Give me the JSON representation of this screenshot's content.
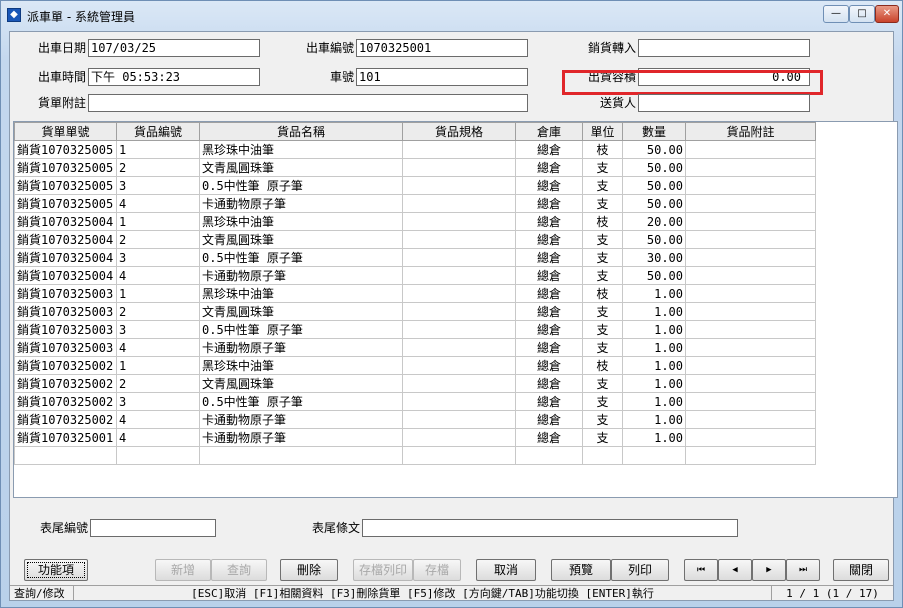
{
  "window": {
    "title": "派車單 - 系統管理員",
    "app_icon": "app-icon"
  },
  "header": {
    "ship_date_label": "出車日期",
    "ship_date_value": "107/03/25",
    "ship_no_label": "出車編號",
    "ship_no_value": "1070325001",
    "sales_import_label": "銷貨轉入",
    "sales_import_value": "",
    "ship_time_label": "出車時間",
    "ship_time_value": "下午 05:53:23",
    "car_no_label": "車號",
    "car_no_value": "101",
    "volume_label": "出貨容積",
    "volume_value": "0.00",
    "note_label": "貨單附註",
    "note_value": "",
    "sender_label": "送貨人",
    "sender_value": "",
    "highlight_color": "#e0262a"
  },
  "table": {
    "columns": [
      "貨單單號",
      "貨品編號",
      "貨品名稱",
      "貨品規格",
      "倉庫",
      "單位",
      "數量",
      "貨品附註"
    ],
    "rows": [
      [
        "銷貨1070325005",
        "1",
        "黑珍珠中油筆",
        "",
        "總倉",
        "枝",
        "50.00",
        ""
      ],
      [
        "銷貨1070325005",
        "2",
        "文青風圓珠筆",
        "",
        "總倉",
        "支",
        "50.00",
        ""
      ],
      [
        "銷貨1070325005",
        "3",
        "0.5中性筆 原子筆",
        "",
        "總倉",
        "支",
        "50.00",
        ""
      ],
      [
        "銷貨1070325005",
        "4",
        "卡通動物原子筆",
        "",
        "總倉",
        "支",
        "50.00",
        ""
      ],
      [
        "銷貨1070325004",
        "1",
        "黑珍珠中油筆",
        "",
        "總倉",
        "枝",
        "20.00",
        ""
      ],
      [
        "銷貨1070325004",
        "2",
        "文青風圓珠筆",
        "",
        "總倉",
        "支",
        "50.00",
        ""
      ],
      [
        "銷貨1070325004",
        "3",
        "0.5中性筆 原子筆",
        "",
        "總倉",
        "支",
        "30.00",
        ""
      ],
      [
        "銷貨1070325004",
        "4",
        "卡通動物原子筆",
        "",
        "總倉",
        "支",
        "50.00",
        ""
      ],
      [
        "銷貨1070325003",
        "1",
        "黑珍珠中油筆",
        "",
        "總倉",
        "枝",
        "1.00",
        ""
      ],
      [
        "銷貨1070325003",
        "2",
        "文青風圓珠筆",
        "",
        "總倉",
        "支",
        "1.00",
        ""
      ],
      [
        "銷貨1070325003",
        "3",
        "0.5中性筆 原子筆",
        "",
        "總倉",
        "支",
        "1.00",
        ""
      ],
      [
        "銷貨1070325003",
        "4",
        "卡通動物原子筆",
        "",
        "總倉",
        "支",
        "1.00",
        ""
      ],
      [
        "銷貨1070325002",
        "1",
        "黑珍珠中油筆",
        "",
        "總倉",
        "枝",
        "1.00",
        ""
      ],
      [
        "銷貨1070325002",
        "2",
        "文青風圓珠筆",
        "",
        "總倉",
        "支",
        "1.00",
        ""
      ],
      [
        "銷貨1070325002",
        "3",
        "0.5中性筆 原子筆",
        "",
        "總倉",
        "支",
        "1.00",
        ""
      ],
      [
        "銷貨1070325002",
        "4",
        "卡通動物原子筆",
        "",
        "總倉",
        "支",
        "1.00",
        ""
      ],
      [
        "銷貨1070325001",
        "4",
        "卡通動物原子筆",
        "",
        "總倉",
        "支",
        "1.00",
        ""
      ],
      [
        "",
        "",
        "",
        "",
        "",
        "",
        "",
        ""
      ]
    ]
  },
  "footer": {
    "tail_no_label": "表尾編號",
    "tail_no_value": "",
    "tail_text_label": "表尾條文",
    "tail_text_value": ""
  },
  "buttons": {
    "function": "功能項",
    "add": "新增",
    "query": "查詢",
    "delete": "刪除",
    "save_print": "存檔列印",
    "save": "存檔",
    "cancel": "取消",
    "preview": "預覽",
    "print": "列印",
    "first": "⏮",
    "prev": "◀",
    "next": "▶",
    "last": "⏭",
    "close": "關閉"
  },
  "status": {
    "mode": "查詢/修改",
    "hint": "[ESC]取消 [F1]相關資料 [F3]刪除貨單 [F5]修改 [方向鍵/TAB]功能切換 [ENTER]執行",
    "page": "1 / 1 (1 / 17)"
  }
}
